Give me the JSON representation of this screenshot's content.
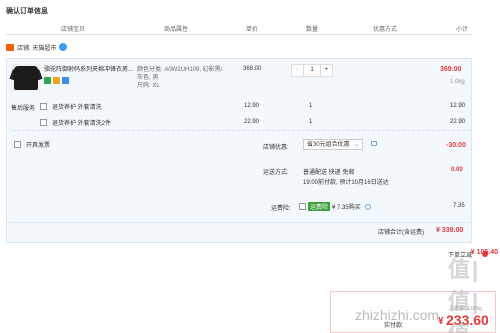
{
  "page_title": "确认订单信息",
  "headers": {
    "shop_baby": "店铺宝贝",
    "attrs": "商品属性",
    "unit_price": "单价",
    "qty": "数量",
    "discount": "优惠方式",
    "subtotal": "小计"
  },
  "shop": {
    "label": "店铺: 天猫超市"
  },
  "product": {
    "name": "骆驼阵御射码系列夹棉冲锋衣男...",
    "attrs": "颜色分类: A0W2UH109, 幻影黑/灰色, 男\n尺码: XL",
    "price": "369.00",
    "qty": "1",
    "qty_minus": "−",
    "qty_plus": "+",
    "subtotal": "369.00",
    "weight": "1.0kg"
  },
  "services": {
    "title": "售后服务",
    "items": [
      {
        "label": "退货养护 外套清洗",
        "price": "12.90",
        "qty": "1",
        "subtotal": "12.90"
      },
      {
        "label": "退货养护 外套清洗2件",
        "price": "22.90",
        "qty": "1",
        "subtotal": "22.90"
      }
    ]
  },
  "invoice": {
    "label": "开具发票"
  },
  "shop_discount": {
    "label": "店铺优惠:",
    "value": "省30元组合优惠",
    "amount": "-30.00"
  },
  "shipping": {
    "label": "运送方式:",
    "line1": "普通配送 快递 免邮",
    "line2": "19:00前付款, 预计10月16日送达",
    "amount": "0.00"
  },
  "freight_insurance": {
    "label": "运费险:",
    "badge": "运费险",
    "desc": "¥ 7.35购买",
    "amount": "7.35"
  },
  "store_total": {
    "label": "店铺合计(含运费)",
    "amount": "¥ 339.00"
  },
  "footer": {
    "saving_label": "下单立减",
    "saving_amount": "¥ 105.40",
    "weight": "总重量: 1.00kg",
    "pay_label": "实付款:",
    "pay_currency": "¥",
    "pay_amount": "233.60"
  },
  "watermark": {
    "logo": "值|值|值",
    "site": "zhizhizhi.com"
  },
  "colors": {
    "accent": "#e4393c",
    "panel_bg": "#f3f8fd",
    "border": "#d9e8f6",
    "wangwang": "#38a1f5",
    "shop_icon": "#ff5a00"
  }
}
